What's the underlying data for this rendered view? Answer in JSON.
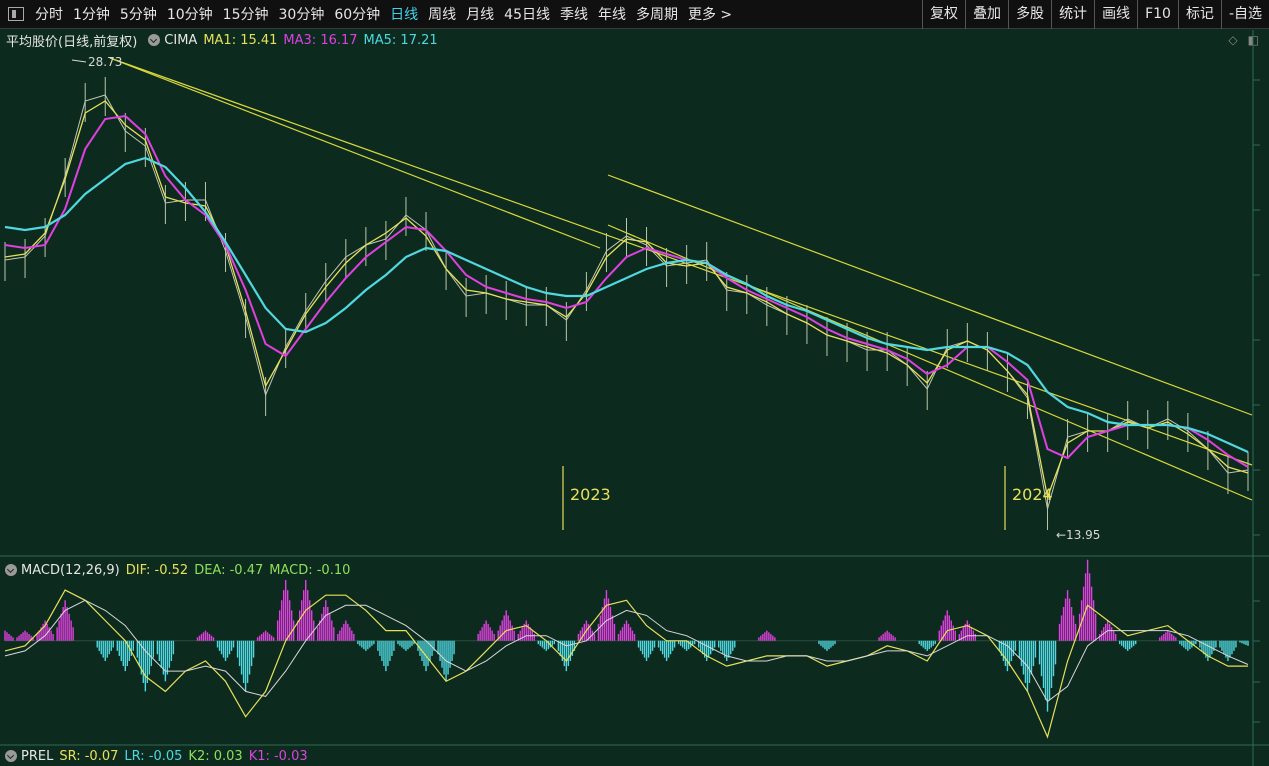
{
  "toolbar": {
    "periods": [
      "分时",
      "1分钟",
      "5分钟",
      "10分钟",
      "15分钟",
      "30分钟",
      "60分钟",
      "日线",
      "周线",
      "月线",
      "45日线",
      "季线",
      "年线",
      "多周期",
      "更多 >"
    ],
    "active_period": "日线",
    "right_buttons": [
      "复权",
      "叠加",
      "多股",
      "统计",
      "画线",
      "F10",
      "标记",
      "-自选"
    ]
  },
  "main_panel": {
    "title": "平均股价(日线,前复权)",
    "indicator": "CIMA",
    "ma1_label": "MA1: 15.41",
    "ma3_label": "MA3: 16.17",
    "ma5_label": "MA5: 17.21",
    "ma1_color": "#e6e05a",
    "ma3_color": "#e040e0",
    "ma5_color": "#4fd8e0",
    "high_marker": "28.73",
    "low_marker": "←13.95",
    "year_labels": [
      "2023",
      "2024"
    ]
  },
  "macd_panel": {
    "title": "MACD(12,26,9)",
    "dif_label": "DIF: -0.52",
    "dea_label": "DEA: -0.47",
    "macd_label": "MACD: -0.10",
    "pos_color": "#e040e0",
    "neg_color": "#4fd8e0"
  },
  "prel_panel": {
    "title": "PREL",
    "sr_label": "SR: -0.07",
    "lr_label": "LR: -0.05",
    "k2_label": "K2: 0.03",
    "k1_label": "K1: -0.03"
  },
  "chart_data": {
    "type": "line",
    "price_series": {
      "x": [
        0,
        20,
        40,
        60,
        80,
        100,
        120,
        140,
        160,
        180,
        200,
        220,
        240,
        260,
        280,
        300,
        320,
        340,
        360,
        380,
        400,
        420,
        440,
        460,
        480,
        500,
        520,
        540,
        560,
        580,
        600,
        620,
        640,
        660,
        680,
        700,
        720,
        740,
        760,
        780,
        800,
        820,
        840,
        860,
        880,
        900,
        920,
        940,
        960,
        980,
        1000,
        1020,
        1040,
        1060,
        1080,
        1100,
        1120,
        1140,
        1160,
        1180,
        1200,
        1220,
        1240
      ],
      "close": [
        22.5,
        22.6,
        23.3,
        25.3,
        27.8,
        28.0,
        26.8,
        26.3,
        24.4,
        24.5,
        24.5,
        22.8,
        20.6,
        18.0,
        19.6,
        20.8,
        21.8,
        22.6,
        23.0,
        23.2,
        24.0,
        23.5,
        22.2,
        21.3,
        21.4,
        21.2,
        21.0,
        21.0,
        20.5,
        21.5,
        22.8,
        23.3,
        23.0,
        22.3,
        22.4,
        22.5,
        21.5,
        21.4,
        21.0,
        20.7,
        20.4,
        20.0,
        19.8,
        19.5,
        19.5,
        19.0,
        18.2,
        19.6,
        19.8,
        19.5,
        18.8,
        17.9,
        14.2,
        16.6,
        16.8,
        16.8,
        17.2,
        16.9,
        17.2,
        16.8,
        16.2,
        15.4,
        15.5
      ],
      "ma1": [
        22.6,
        22.7,
        23.4,
        25.2,
        27.4,
        27.8,
        27.0,
        26.5,
        24.6,
        24.4,
        24.3,
        23.0,
        20.8,
        18.3,
        19.5,
        20.7,
        21.6,
        22.4,
        23.0,
        23.4,
        23.9,
        23.3,
        22.2,
        21.5,
        21.4,
        21.2,
        21.1,
        21.0,
        20.6,
        21.4,
        22.6,
        23.2,
        23.1,
        22.4,
        22.3,
        22.4,
        21.6,
        21.4,
        21.1,
        20.7,
        20.4,
        20.0,
        19.8,
        19.6,
        19.4,
        19.0,
        18.4,
        19.5,
        19.8,
        19.5,
        18.8,
        18.0,
        14.6,
        16.4,
        16.8,
        16.8,
        17.1,
        16.9,
        17.1,
        16.7,
        16.2,
        15.6,
        15.4
      ],
      "ma3": [
        23.0,
        22.9,
        23.0,
        24.2,
        26.2,
        27.2,
        27.3,
        26.7,
        25.3,
        24.5,
        24.0,
        23.0,
        21.5,
        19.7,
        19.3,
        20.2,
        21.1,
        21.9,
        22.6,
        23.1,
        23.6,
        23.5,
        22.8,
        22.0,
        21.6,
        21.4,
        21.2,
        21.1,
        20.9,
        21.1,
        21.9,
        22.6,
        22.9,
        22.7,
        22.5,
        22.4,
        21.9,
        21.5,
        21.2,
        20.9,
        20.6,
        20.2,
        19.9,
        19.7,
        19.5,
        19.2,
        18.7,
        19.0,
        19.6,
        19.6,
        19.1,
        18.5,
        16.2,
        15.9,
        16.6,
        16.8,
        17.0,
        17.0,
        17.0,
        16.9,
        16.5,
        16.0,
        15.6
      ],
      "ma5": [
        23.6,
        23.5,
        23.6,
        24.0,
        24.7,
        25.2,
        25.7,
        25.9,
        25.6,
        24.9,
        24.1,
        23.1,
        22.0,
        20.9,
        20.2,
        20.1,
        20.4,
        20.9,
        21.5,
        22.0,
        22.6,
        22.9,
        22.8,
        22.5,
        22.2,
        21.9,
        21.6,
        21.4,
        21.3,
        21.3,
        21.6,
        21.9,
        22.2,
        22.4,
        22.5,
        22.4,
        22.0,
        21.7,
        21.3,
        21.0,
        20.8,
        20.5,
        20.2,
        19.9,
        19.7,
        19.6,
        19.5,
        19.6,
        19.6,
        19.6,
        19.4,
        19.0,
        18.1,
        17.6,
        17.4,
        17.1,
        17.0,
        17.0,
        17.0,
        16.9,
        16.7,
        16.4,
        16.1
      ]
    },
    "macd_series": {
      "x": [
        0,
        20,
        40,
        60,
        80,
        100,
        120,
        140,
        160,
        180,
        200,
        220,
        240,
        260,
        280,
        300,
        320,
        340,
        360,
        380,
        400,
        420,
        440,
        460,
        480,
        500,
        520,
        540,
        560,
        580,
        600,
        620,
        640,
        660,
        680,
        700,
        720,
        740,
        760,
        780,
        800,
        820,
        840,
        860,
        880,
        900,
        920,
        940,
        960,
        980,
        1000,
        1020,
        1040,
        1060,
        1080,
        1100,
        1120,
        1140,
        1160,
        1180,
        1200,
        1220,
        1240
      ],
      "dif": [
        -0.2,
        -0.1,
        0.3,
        1.0,
        0.8,
        0.4,
        0.0,
        -0.7,
        -1.0,
        -0.6,
        -0.4,
        -0.8,
        -1.5,
        -1.0,
        0.0,
        0.6,
        0.9,
        0.9,
        0.6,
        0.2,
        0.2,
        -0.3,
        -0.8,
        -0.6,
        -0.2,
        0.2,
        0.3,
        0.0,
        -0.4,
        0.2,
        0.7,
        0.8,
        0.3,
        0.0,
        0.0,
        -0.3,
        -0.5,
        -0.4,
        -0.3,
        -0.3,
        -0.3,
        -0.5,
        -0.4,
        -0.3,
        -0.1,
        -0.2,
        -0.4,
        0.2,
        0.3,
        0.1,
        -0.4,
        -1.0,
        -1.9,
        -0.4,
        0.7,
        0.4,
        0.1,
        0.2,
        0.3,
        0.0,
        -0.3,
        -0.5,
        -0.5
      ],
      "dea": [
        -0.3,
        -0.2,
        0.1,
        0.6,
        0.8,
        0.6,
        0.3,
        -0.2,
        -0.6,
        -0.6,
        -0.5,
        -0.6,
        -1.0,
        -1.1,
        -0.6,
        0.0,
        0.5,
        0.7,
        0.7,
        0.5,
        0.3,
        0.0,
        -0.4,
        -0.6,
        -0.4,
        -0.1,
        0.1,
        0.1,
        -0.1,
        0.0,
        0.4,
        0.6,
        0.5,
        0.2,
        0.1,
        -0.1,
        -0.3,
        -0.4,
        -0.4,
        -0.3,
        -0.3,
        -0.4,
        -0.4,
        -0.3,
        -0.2,
        -0.2,
        -0.3,
        -0.1,
        0.1,
        0.1,
        -0.1,
        -0.5,
        -1.2,
        -0.9,
        -0.1,
        0.2,
        0.2,
        0.2,
        0.2,
        0.1,
        -0.1,
        -0.3,
        -0.47
      ],
      "macd": [
        0.2,
        0.2,
        0.4,
        0.8,
        0.0,
        -0.4,
        -0.6,
        -1.0,
        -0.8,
        0.0,
        0.2,
        -0.4,
        -1.0,
        0.2,
        1.2,
        1.2,
        0.8,
        0.4,
        -0.2,
        -0.6,
        -0.2,
        -0.6,
        -0.8,
        0.0,
        0.4,
        0.6,
        0.4,
        -0.2,
        -0.6,
        0.4,
        1.0,
        0.4,
        -0.4,
        -0.4,
        -0.2,
        -0.4,
        -0.4,
        0.0,
        0.2,
        0.0,
        0.0,
        -0.2,
        0.0,
        0.0,
        0.2,
        0.0,
        -0.2,
        0.6,
        0.4,
        0.0,
        -0.6,
        -1.0,
        -1.4,
        1.0,
        1.6,
        0.4,
        -0.2,
        0.0,
        0.2,
        -0.2,
        -0.4,
        -0.4,
        -0.1
      ]
    },
    "price_ylim": [
      13.5,
      29.5
    ],
    "macd_ylim": [
      -2.0,
      1.2
    ],
    "annotations": [
      "28.73",
      "←13.95",
      "2023",
      "2024"
    ],
    "grid": false
  }
}
